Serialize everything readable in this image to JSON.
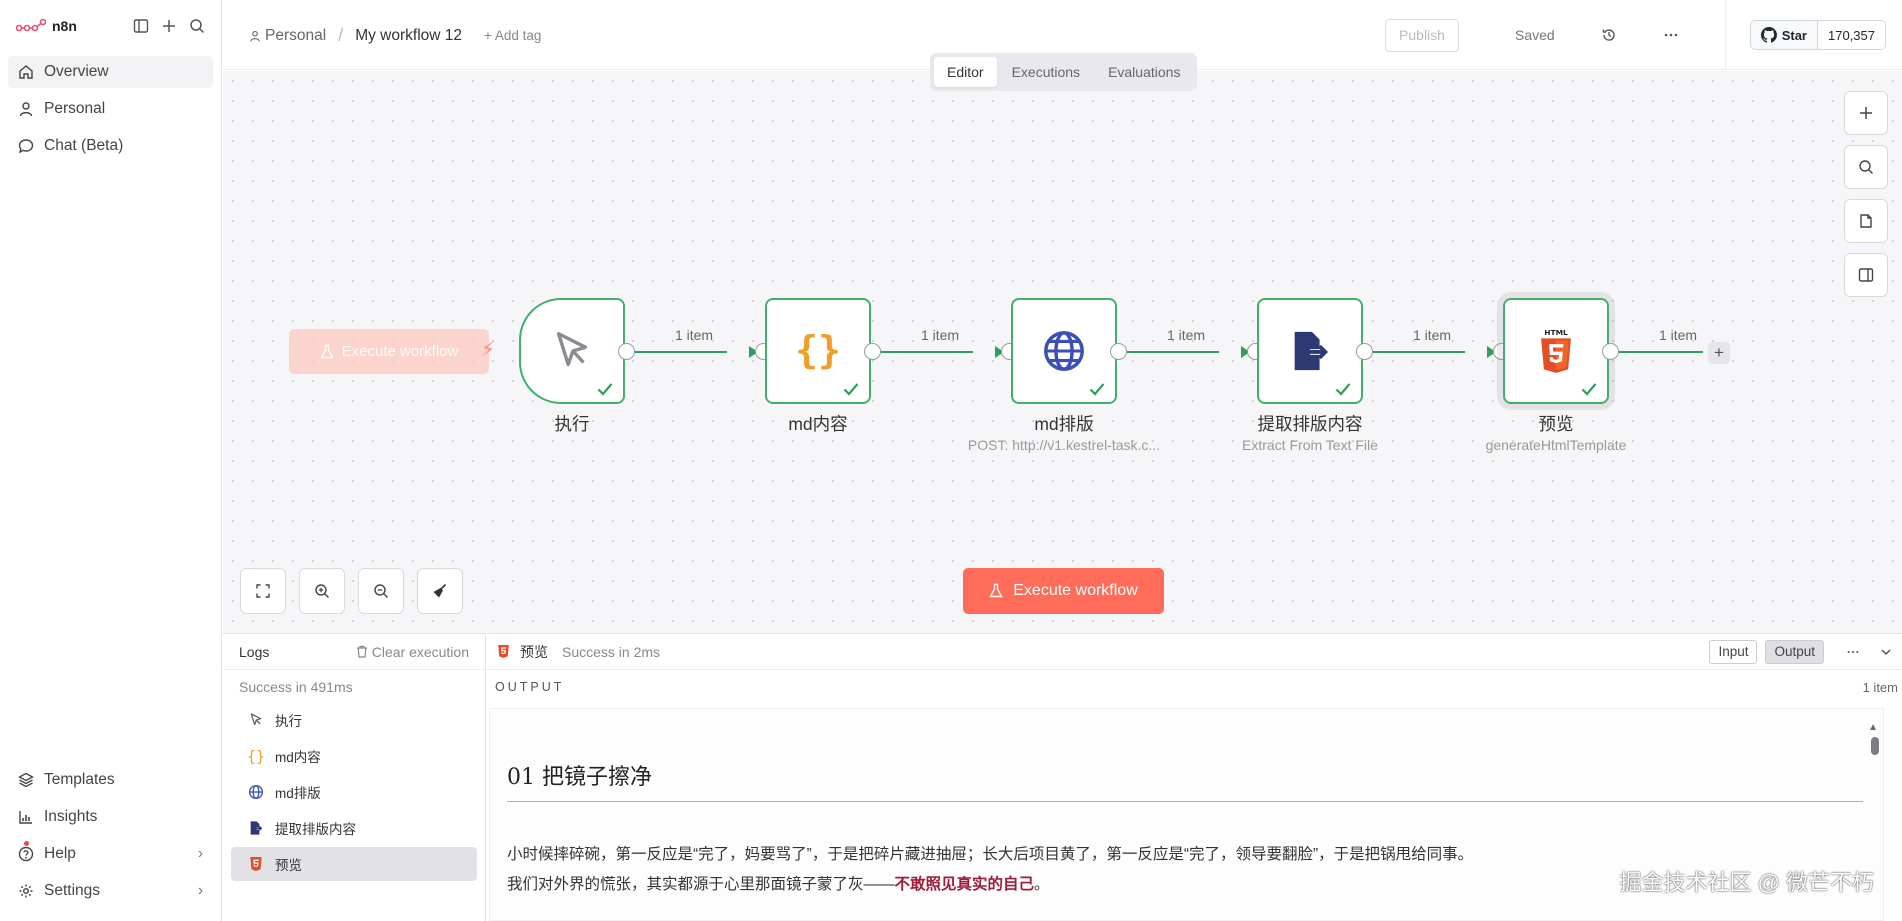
{
  "brand": {
    "name": "n8n"
  },
  "sidebar": {
    "items": [
      {
        "label": "Overview"
      },
      {
        "label": "Personal"
      },
      {
        "label": "Chat (Beta)"
      }
    ],
    "bottom": [
      {
        "label": "Templates"
      },
      {
        "label": "Insights"
      },
      {
        "label": "Help"
      },
      {
        "label": "Settings"
      }
    ]
  },
  "header": {
    "breadcrumb_project": "Personal",
    "breadcrumb_sep": "/",
    "workflow_name": "My workflow 12",
    "add_tag": "+ Add tag",
    "publish_label": "Publish",
    "saved_label": "Saved",
    "github_star": "Star",
    "github_count": "170,357"
  },
  "tabs": [
    {
      "label": "Editor"
    },
    {
      "label": "Executions"
    },
    {
      "label": "Evaluations"
    }
  ],
  "canvas": {
    "ghost_execute": "Execute workflow",
    "execute_label": "Execute workflow",
    "nodes": [
      {
        "title": "执行",
        "subtitle": ""
      },
      {
        "title": "md内容",
        "subtitle": ""
      },
      {
        "title": "md排版",
        "subtitle": "POST: http://v1.kestrel-task.c..."
      },
      {
        "title": "提取排版内容",
        "subtitle": "Extract From Text File"
      },
      {
        "title": "预览",
        "subtitle": "generateHtmlTemplate"
      }
    ],
    "edge_labels": [
      "1 item",
      "1 item",
      "1 item",
      "1 item",
      "1 item"
    ]
  },
  "logs": {
    "title": "Logs",
    "clear_label": "Clear execution",
    "status": "Success in 491ms",
    "items": [
      {
        "label": "执行"
      },
      {
        "label": "md内容"
      },
      {
        "label": "md排版"
      },
      {
        "label": "提取排版内容"
      },
      {
        "label": "预览"
      }
    ]
  },
  "output": {
    "node_name": "预览",
    "status": "Success in 2ms",
    "input_label": "Input",
    "output_label": "Output",
    "section_label": "OUTPUT",
    "item_count": "1 item",
    "doc": {
      "heading": "01 把镜子擦净",
      "p1": "小时候摔碎碗，第一反应是“完了，妈要骂了”，于是把碎片藏进抽屉；长大后项目黄了，第一反应是“完了，领导要翻脸”，于是把锅甩给同事。",
      "p2_prefix": "我们对外界的慌张，其实都源于心里那面镜子蒙了灰——",
      "p2_em": "不敢照见真实的自己",
      "p2_suffix": "。"
    }
  },
  "watermark": "掘金技术社区 @ 微芒不朽",
  "colors": {
    "accent": "#ff6d5a",
    "success": "#2f9e5c",
    "node_border": "#41b06a"
  }
}
